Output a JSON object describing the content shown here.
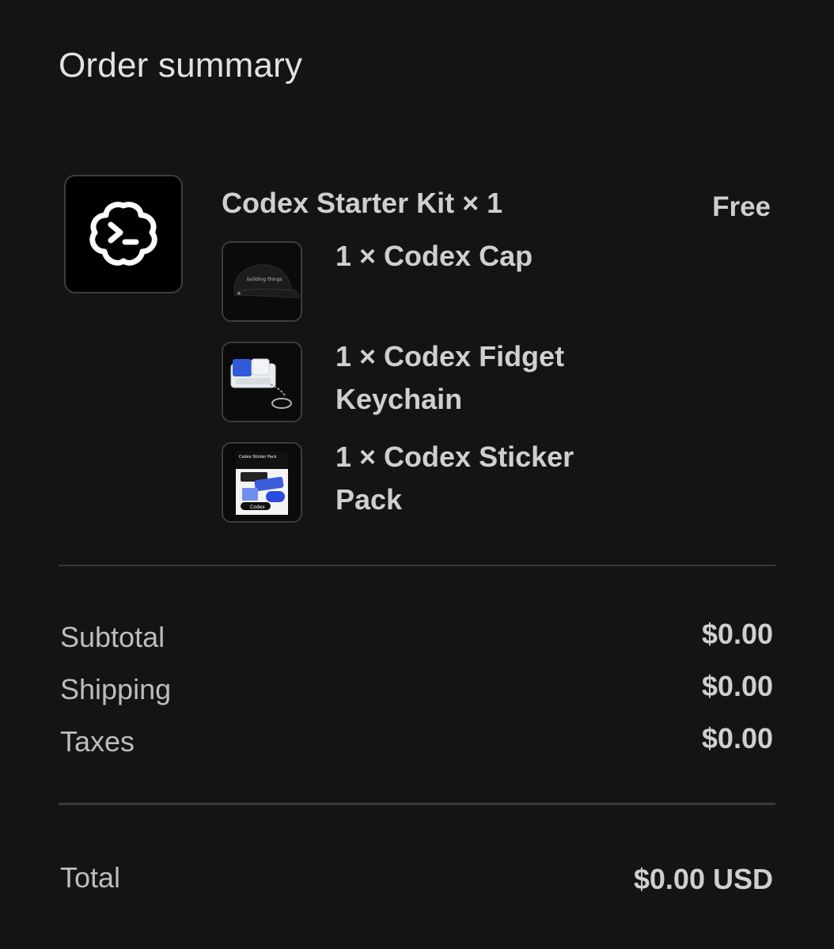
{
  "header": {
    "title": "Order summary"
  },
  "order_item": {
    "name": "Codex Starter Kit × 1",
    "price": "Free",
    "logo_icon": "codex-terminal-cloud-icon",
    "contents": [
      {
        "label": "1 × Codex Cap",
        "icon": "cap-image"
      },
      {
        "label": "1 × Codex Fidget Keychain",
        "icon": "keychain-image"
      },
      {
        "label": "1 × Codex Sticker Pack",
        "icon": "sticker-pack-image"
      }
    ],
    "cap_print": "building things",
    "sticker_pack_title": "Codex Sticker Pack",
    "sticker_brand": "Codex"
  },
  "totals": {
    "subtotal_label": "Subtotal",
    "subtotal_value": "$0.00",
    "shipping_label": "Shipping",
    "shipping_value": "$0.00",
    "taxes_label": "Taxes",
    "taxes_value": "$0.00",
    "total_label": "Total",
    "total_value": "$0.00 USD"
  },
  "colors": {
    "background": "#141416",
    "text_primary": "#cfcfcf",
    "text_secondary": "#bdbdbd",
    "divider": "#3a3a3d",
    "accent_blue": "#3b5bdb"
  }
}
